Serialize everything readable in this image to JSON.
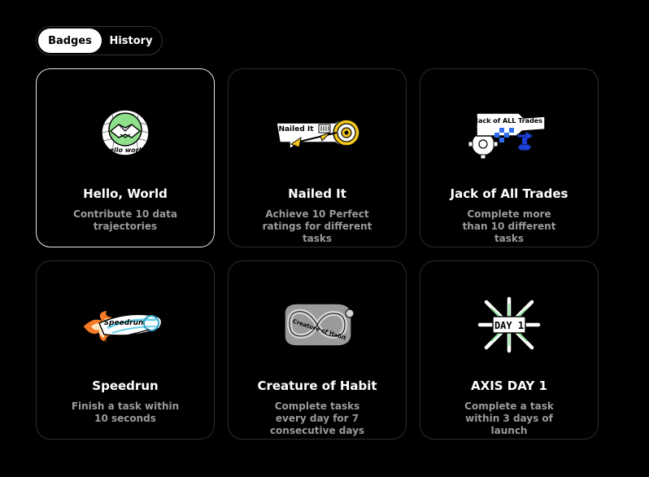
{
  "tabs": {
    "badges": "Badges",
    "history": "History"
  },
  "badges": [
    {
      "title": "Hello, World",
      "description": "Contribute 10 data trajectories",
      "art_text": "hello world",
      "icon": "handshake-badge-icon"
    },
    {
      "title": "Nailed It",
      "description": "Achieve 10 Perfect ratings for different tasks",
      "art_text": "Nailed It",
      "icon": "dart-target-badge-icon"
    },
    {
      "title": "Jack of All Trades",
      "description": "Complete more than 10 different tasks",
      "art_text": "Jack of ALL Trades",
      "icon": "gear-puzzle-badge-icon"
    },
    {
      "title": "Speedrun",
      "description": "Finish a task within 10 seconds",
      "art_text": "Speedrun",
      "icon": "flaming-speed-badge-icon"
    },
    {
      "title": "Creature of Habit",
      "description": "Complete tasks every day for 7 consecutive days",
      "art_text": "Creature of Habit",
      "icon": "infinity-badge-icon"
    },
    {
      "title": "AXIS DAY 1",
      "description": "Complete a task within 3 days of launch",
      "art_text": "DAY 1",
      "icon": "starburst-day1-badge-icon"
    }
  ]
}
